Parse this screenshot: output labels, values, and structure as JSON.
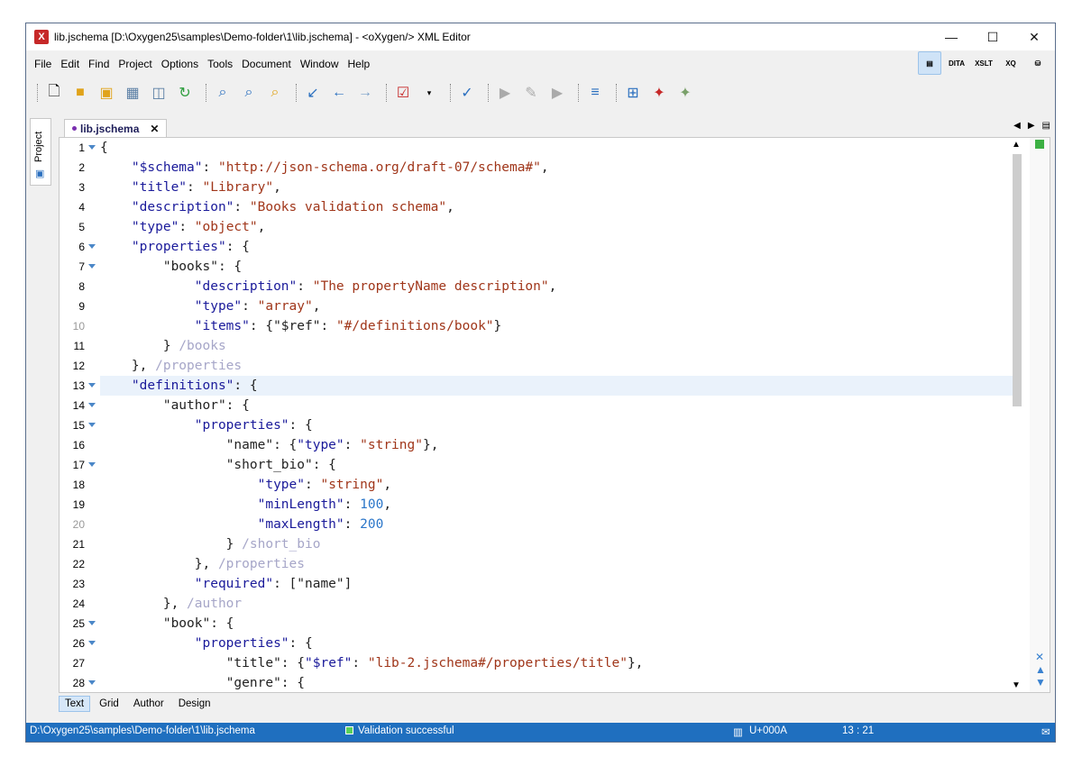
{
  "window": {
    "title": "lib.jschema [D:\\Oxygen25\\samples\\Demo-folder\\1\\lib.jschema] - <oXygen/> XML Editor",
    "controls": [
      "—",
      "☐",
      "✕"
    ]
  },
  "menu": [
    "File",
    "Edit",
    "Find",
    "Project",
    "Options",
    "Tools",
    "Document",
    "Window",
    "Help"
  ],
  "perspectives": [
    {
      "icon": "editor-perspective-icon",
      "label": ""
    },
    {
      "icon": "dita-perspective-icon",
      "label": "DITA"
    },
    {
      "icon": "xslt-debugger-icon",
      "label": "XSLT"
    },
    {
      "icon": "xquery-debugger-icon",
      "label": "XQ"
    },
    {
      "icon": "database-perspective-icon",
      "label": ""
    }
  ],
  "sidebar": {
    "label": "Project"
  },
  "editor": {
    "tab_label": "lib.jschema",
    "lines": [
      {
        "n": "1",
        "fold": true,
        "parts": [
          [
            "p",
            "{"
          ]
        ]
      },
      {
        "n": "2",
        "parts": [
          [
            "p",
            "    "
          ],
          [
            "k",
            "\"$schema\""
          ],
          [
            "p",
            ": "
          ],
          [
            "s",
            "\"http://json-schema.org/draft-07/schema#\""
          ],
          [
            "p",
            ","
          ]
        ]
      },
      {
        "n": "3",
        "parts": [
          [
            "p",
            "    "
          ],
          [
            "k",
            "\"title\""
          ],
          [
            "p",
            ": "
          ],
          [
            "s",
            "\"Library\""
          ],
          [
            "p",
            ","
          ]
        ]
      },
      {
        "n": "4",
        "parts": [
          [
            "p",
            "    "
          ],
          [
            "k",
            "\"description\""
          ],
          [
            "p",
            ": "
          ],
          [
            "s",
            "\"Books validation schema\""
          ],
          [
            "p",
            ","
          ]
        ]
      },
      {
        "n": "5",
        "parts": [
          [
            "p",
            "    "
          ],
          [
            "k",
            "\"type\""
          ],
          [
            "p",
            ": "
          ],
          [
            "s",
            "\"object\""
          ],
          [
            "p",
            ","
          ]
        ]
      },
      {
        "n": "6",
        "fold": true,
        "parts": [
          [
            "p",
            "    "
          ],
          [
            "k",
            "\"properties\""
          ],
          [
            "p",
            ": {"
          ]
        ]
      },
      {
        "n": "7",
        "fold": true,
        "parts": [
          [
            "p",
            "        "
          ],
          [
            "p",
            "\"books\": {"
          ]
        ]
      },
      {
        "n": "8",
        "parts": [
          [
            "p",
            "            "
          ],
          [
            "k",
            "\"description\""
          ],
          [
            "p",
            ": "
          ],
          [
            "s",
            "\"The propertyName description\""
          ],
          [
            "p",
            ","
          ]
        ]
      },
      {
        "n": "9",
        "parts": [
          [
            "p",
            "            "
          ],
          [
            "k",
            "\"type\""
          ],
          [
            "p",
            ": "
          ],
          [
            "s",
            "\"array\""
          ],
          [
            "p",
            ","
          ]
        ]
      },
      {
        "n": "10",
        "dim": true,
        "parts": [
          [
            "p",
            "            "
          ],
          [
            "k",
            "\"items\""
          ],
          [
            "p",
            ": {"
          ],
          [
            "p",
            "\"$ref\""
          ],
          [
            "p",
            ": "
          ],
          [
            "s",
            "\"#/definitions/book\""
          ],
          [
            "p",
            "}"
          ]
        ]
      },
      {
        "n": "11",
        "parts": [
          [
            "p",
            "        } "
          ],
          [
            "c",
            "/books"
          ]
        ]
      },
      {
        "n": "12",
        "parts": [
          [
            "p",
            "    }, "
          ],
          [
            "c",
            "/properties"
          ]
        ]
      },
      {
        "n": "13",
        "fold": true,
        "current": true,
        "parts": [
          [
            "p",
            "    "
          ],
          [
            "k",
            "\"definitions\""
          ],
          [
            "p",
            ": {"
          ]
        ]
      },
      {
        "n": "14",
        "fold": true,
        "parts": [
          [
            "p",
            "        "
          ],
          [
            "p",
            "\"author\": {"
          ]
        ]
      },
      {
        "n": "15",
        "fold": true,
        "parts": [
          [
            "p",
            "            "
          ],
          [
            "k",
            "\"properties\""
          ],
          [
            "p",
            ": {"
          ]
        ]
      },
      {
        "n": "16",
        "parts": [
          [
            "p",
            "                "
          ],
          [
            "p",
            "\"name\": {"
          ],
          [
            "k",
            "\"type\""
          ],
          [
            "p",
            ": "
          ],
          [
            "s",
            "\"string\""
          ],
          [
            "p",
            "},"
          ]
        ]
      },
      {
        "n": "17",
        "fold": true,
        "parts": [
          [
            "p",
            "                "
          ],
          [
            "p",
            "\"short_bio\": {"
          ]
        ]
      },
      {
        "n": "18",
        "parts": [
          [
            "p",
            "                    "
          ],
          [
            "k",
            "\"type\""
          ],
          [
            "p",
            ": "
          ],
          [
            "s",
            "\"string\""
          ],
          [
            "p",
            ","
          ]
        ]
      },
      {
        "n": "19",
        "parts": [
          [
            "p",
            "                    "
          ],
          [
            "k",
            "\"minLength\""
          ],
          [
            "p",
            ": "
          ],
          [
            "n",
            "100"
          ],
          [
            "p",
            ","
          ]
        ]
      },
      {
        "n": "20",
        "dim": true,
        "parts": [
          [
            "p",
            "                    "
          ],
          [
            "k",
            "\"maxLength\""
          ],
          [
            "p",
            ": "
          ],
          [
            "n",
            "200"
          ]
        ]
      },
      {
        "n": "21",
        "parts": [
          [
            "p",
            "                } "
          ],
          [
            "c",
            "/short_bio"
          ]
        ]
      },
      {
        "n": "22",
        "parts": [
          [
            "p",
            "            }, "
          ],
          [
            "c",
            "/properties"
          ]
        ]
      },
      {
        "n": "23",
        "parts": [
          [
            "p",
            "            "
          ],
          [
            "k",
            "\"required\""
          ],
          [
            "p",
            ": [\"name\"]"
          ]
        ]
      },
      {
        "n": "24",
        "parts": [
          [
            "p",
            "        }, "
          ],
          [
            "c",
            "/author"
          ]
        ]
      },
      {
        "n": "25",
        "fold": true,
        "parts": [
          [
            "p",
            "        "
          ],
          [
            "p",
            "\"book\": {"
          ]
        ]
      },
      {
        "n": "26",
        "fold": true,
        "parts": [
          [
            "p",
            "            "
          ],
          [
            "k",
            "\"properties\""
          ],
          [
            "p",
            ": {"
          ]
        ]
      },
      {
        "n": "27",
        "parts": [
          [
            "p",
            "                "
          ],
          [
            "p",
            "\"title\": {"
          ],
          [
            "k",
            "\"$ref\""
          ],
          [
            "p",
            ": "
          ],
          [
            "s",
            "\"lib-2.jschema#/properties/title\""
          ],
          [
            "p",
            "},"
          ]
        ]
      },
      {
        "n": "28",
        "fold": true,
        "parts": [
          [
            "p",
            "                "
          ],
          [
            "p",
            "\"genre\": {"
          ]
        ]
      }
    ]
  },
  "modes": [
    "Text",
    "Grid",
    "Author",
    "Design"
  ],
  "status": {
    "path": "D:\\Oxygen25\\samples\\Demo-folder\\1\\lib.jschema",
    "validation": "Validation successful",
    "char": "U+000A",
    "position": "13 : 21"
  },
  "colors": {
    "statusbar": "#1f6fbf",
    "key": "#1a1a9a",
    "string": "#a0361a",
    "number": "#2b76c9",
    "comment": "#a6a6c8"
  }
}
